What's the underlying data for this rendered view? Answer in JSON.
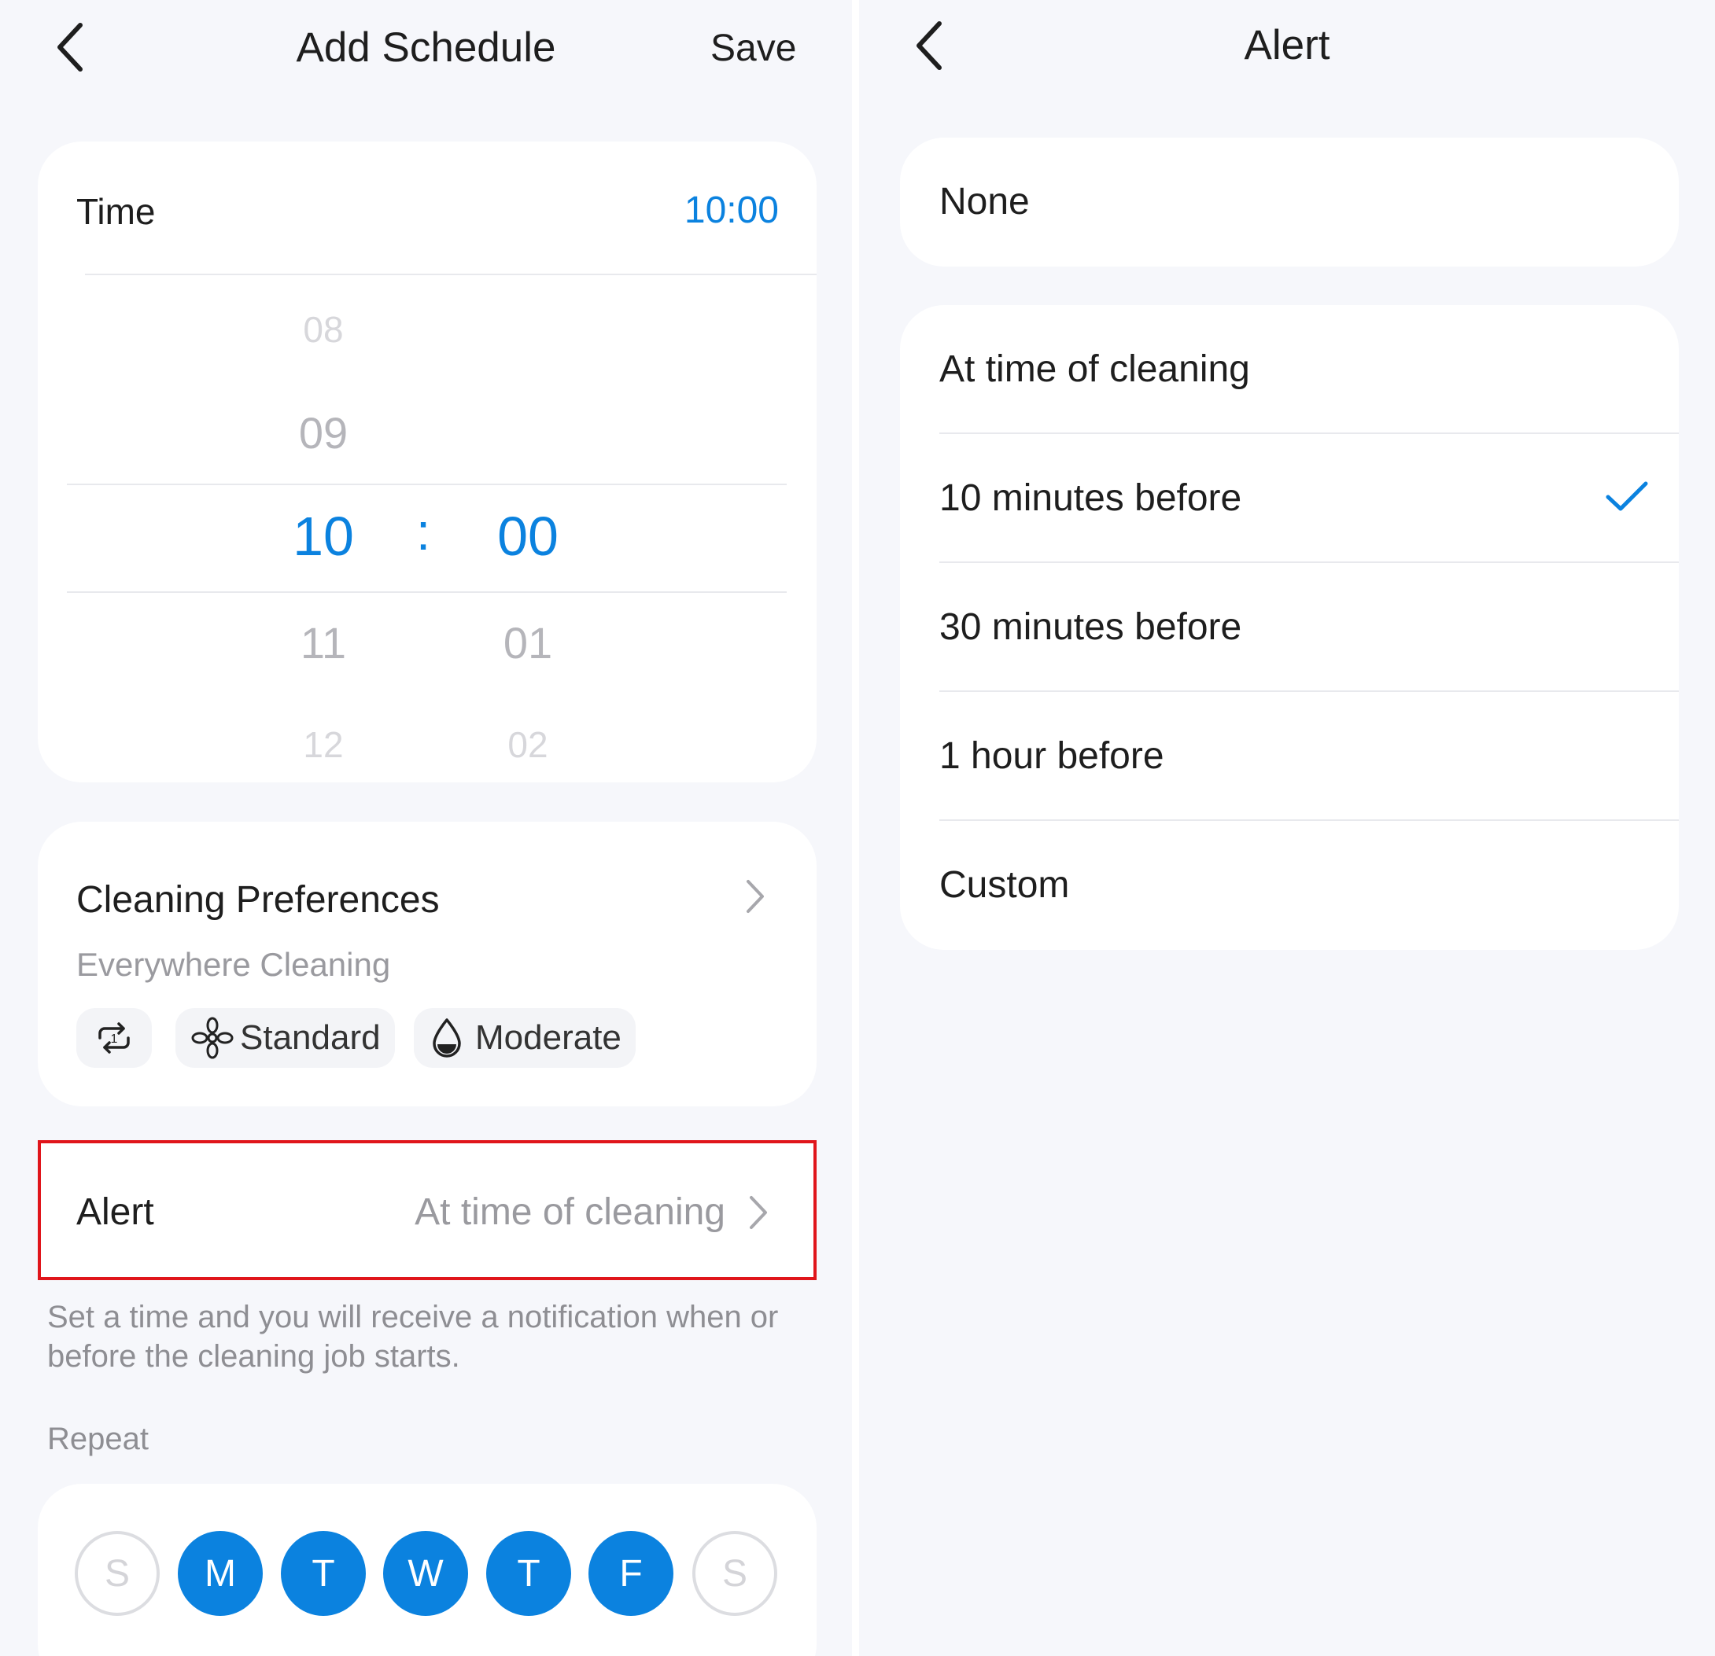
{
  "left": {
    "header": {
      "title": "Add Schedule",
      "save_label": "Save"
    },
    "time_card": {
      "label": "Time",
      "value": "10:00",
      "hours": [
        "08",
        "09",
        "10",
        "11",
        "12"
      ],
      "minutes": [
        "00",
        "01",
        "02"
      ],
      "separator": ":"
    },
    "preferences": {
      "title": "Cleaning Preferences",
      "subtitle": "Everywhere Cleaning",
      "chips": [
        {
          "icon": "repeat-once-icon",
          "label": ""
        },
        {
          "icon": "fan-icon",
          "label": "Standard"
        },
        {
          "icon": "water-drop-icon",
          "label": "Moderate"
        }
      ]
    },
    "alert": {
      "label": "Alert",
      "value": "At time of cleaning"
    },
    "note": "Set a time and you will receive a notification when or before the cleaning job starts.",
    "repeat": {
      "label": "Repeat",
      "days": [
        {
          "letter": "S",
          "selected": false
        },
        {
          "letter": "M",
          "selected": true
        },
        {
          "letter": "T",
          "selected": true
        },
        {
          "letter": "W",
          "selected": true
        },
        {
          "letter": "T",
          "selected": true
        },
        {
          "letter": "F",
          "selected": true
        },
        {
          "letter": "S",
          "selected": false
        }
      ]
    }
  },
  "right": {
    "header": {
      "title": "Alert"
    },
    "none_option": "None",
    "options": [
      {
        "label": "At time of cleaning",
        "selected": false
      },
      {
        "label": "10 minutes before",
        "selected": true
      },
      {
        "label": "30 minutes before",
        "selected": false
      },
      {
        "label": "1 hour before",
        "selected": false
      },
      {
        "label": "Custom",
        "selected": false
      }
    ]
  },
  "colors": {
    "accent": "#0b82df",
    "highlight_border": "#e0151b",
    "background": "#f6f7fb"
  }
}
